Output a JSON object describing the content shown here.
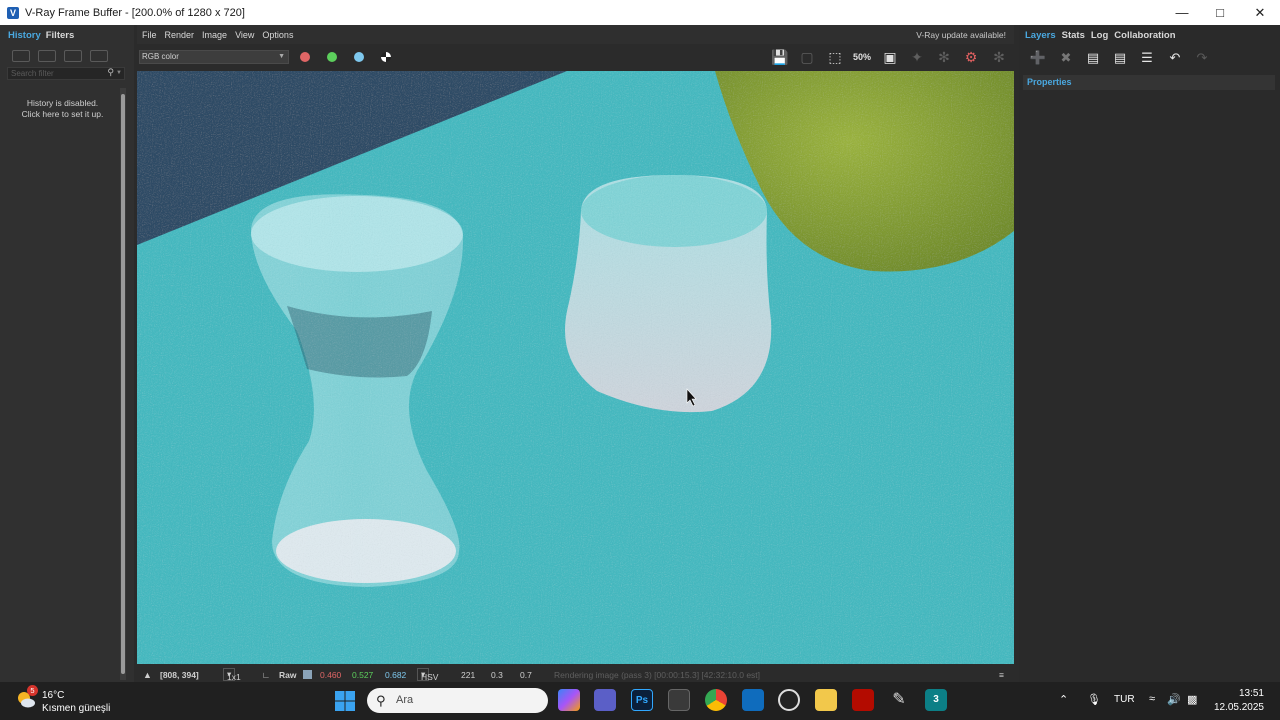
{
  "window": {
    "title": "V-Ray Frame Buffer - [200.0% of 1280 x 720]"
  },
  "left_panel": {
    "tabs": [
      {
        "label": "History"
      },
      {
        "label": "Filters"
      }
    ],
    "search_placeholder": "Search filter",
    "history_message": [
      "History is disabled.",
      "Click here to set it up."
    ]
  },
  "menu": {
    "items": [
      "File",
      "Render",
      "Image",
      "View",
      "Options"
    ],
    "update_notice": "V-Ray update available!"
  },
  "toolbar": {
    "channel": "RGB color",
    "zoom_label": "50%"
  },
  "right_panel": {
    "tabs": [
      {
        "label": "Layers"
      },
      {
        "label": "Stats"
      },
      {
        "label": "Log"
      },
      {
        "label": "Collaboration"
      }
    ],
    "properties_label": "Properties"
  },
  "status": {
    "coords": "[808, 394]",
    "sampling": "1x1",
    "mode": "Raw",
    "r": "0.460",
    "g": "0.527",
    "b": "0.682",
    "color_space": "HSV",
    "h": "221",
    "s": "0.3",
    "v": "0.7",
    "message": "Rendering image (pass 3) [00:00:15.3] [42:32:10.0 est]"
  },
  "taskbar": {
    "weather_temp": "16°C",
    "weather_desc": "Kısmen güneşli",
    "weather_badge": "5",
    "search_placeholder": "Ara",
    "language": "TUR",
    "time": "13:51",
    "date": "12.05.2025",
    "ps_label": "Ps",
    "max_label": "3"
  },
  "colors": {
    "accent": "#4aa8e0",
    "red_channel": "#e06666",
    "green_channel": "#5ccf5c",
    "blue_channel": "#7ec8ee",
    "table_cyan": "#46b9c0",
    "wall_navy": "#2e4c66",
    "bowl_green": "#8aa43a"
  }
}
